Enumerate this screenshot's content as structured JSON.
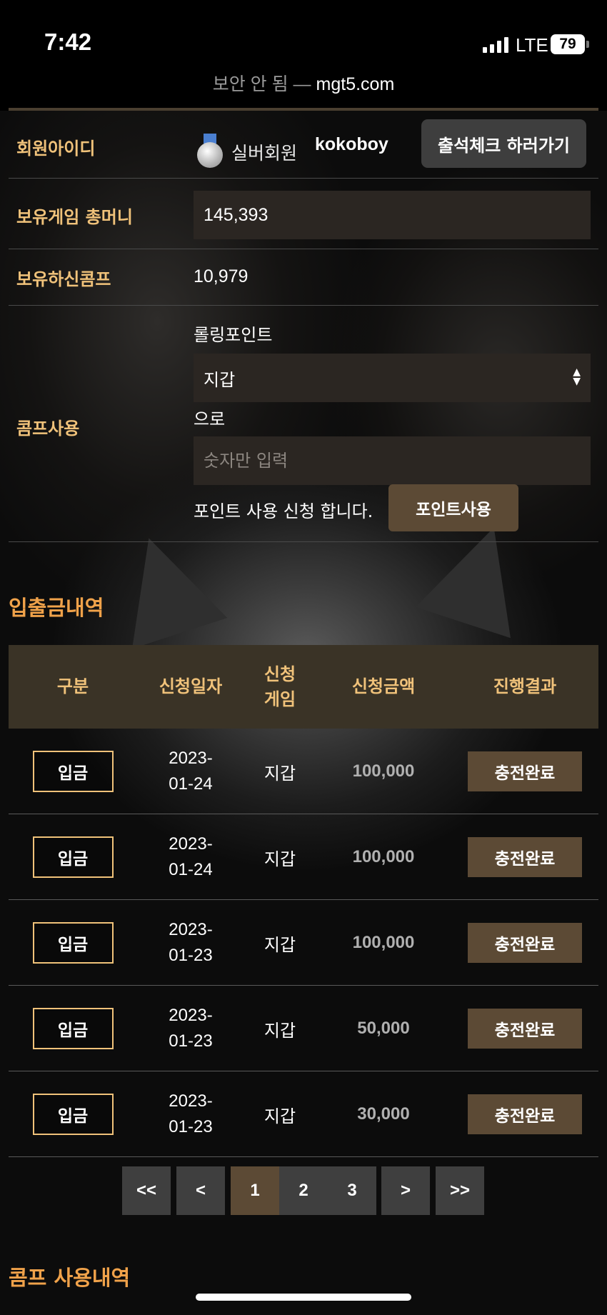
{
  "status_bar": {
    "time": "7:42",
    "network": "LTE",
    "battery": "79"
  },
  "browser": {
    "security_text": "보안 안 됨 —",
    "domain": "mgt5.com"
  },
  "member": {
    "id_label": "회원아이디",
    "grade": "실버회원",
    "user_id": "kokoboy",
    "attendance_button": "출석체크 하러가기"
  },
  "money": {
    "label": "보유게임 총머니",
    "value": "145,393"
  },
  "comp": {
    "label": "보유하신콤프",
    "value": "10,979"
  },
  "comp_use": {
    "label": "콤프사용",
    "rolling_text": "롤링포인트",
    "select_value": "지갑",
    "to_text": "으로",
    "input_placeholder": "숫자만 입력",
    "request_text": "포인트 사용 신청 합니다.",
    "button_label": "포인트사용"
  },
  "transactions": {
    "title": "입출금내역",
    "headers": [
      "구분",
      "신청일자",
      "신청\n게임",
      "신청금액",
      "진행결과"
    ],
    "rows": [
      {
        "type": "입금",
        "date": "2023-\n01-24",
        "game": "지갑",
        "amount": "100,000",
        "result": "충전완료"
      },
      {
        "type": "입금",
        "date": "2023-\n01-24",
        "game": "지갑",
        "amount": "100,000",
        "result": "충전완료"
      },
      {
        "type": "입금",
        "date": "2023-\n01-23",
        "game": "지갑",
        "amount": "100,000",
        "result": "충전완료"
      },
      {
        "type": "입금",
        "date": "2023-\n01-23",
        "game": "지갑",
        "amount": "50,000",
        "result": "충전완료"
      },
      {
        "type": "입금",
        "date": "2023-\n01-23",
        "game": "지갑",
        "amount": "30,000",
        "result": "충전완료"
      }
    ]
  },
  "pagination": {
    "first": "<<",
    "prev": "<",
    "pages": [
      "1",
      "2",
      "3"
    ],
    "current": "1",
    "next": ">",
    "last": ">>"
  },
  "comp_history": {
    "title": "콤프 사용내역"
  }
}
